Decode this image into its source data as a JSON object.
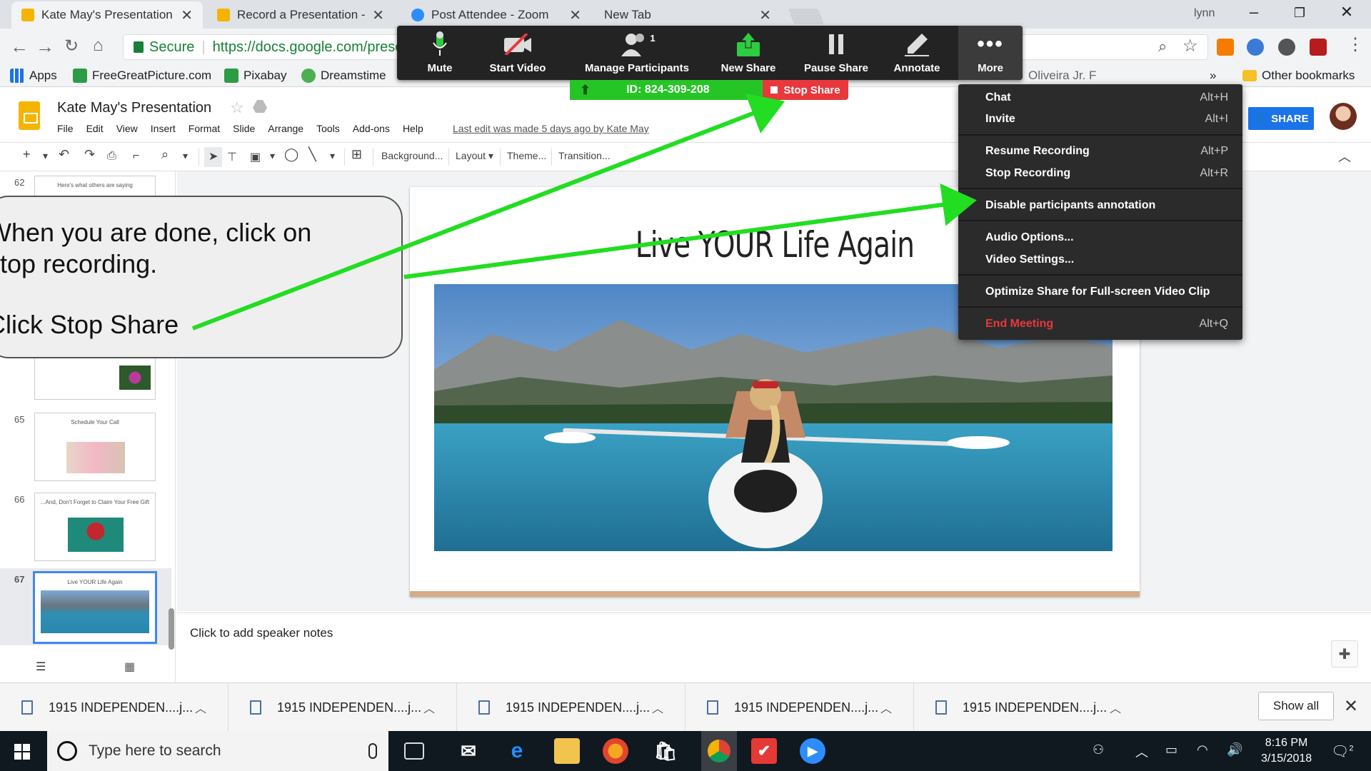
{
  "browser": {
    "tabs": [
      {
        "title": "Kate May's Presentation",
        "fav_color": "#f4b400"
      },
      {
        "title": "Record a Presentation - (",
        "fav_color": "#f4b400"
      },
      {
        "title": "Post Attendee - Zoom",
        "fav_color": "#2d8cff"
      },
      {
        "title": "New Tab",
        "fav_color": ""
      }
    ],
    "user": "lynn",
    "secure_label": "Secure",
    "url": "https://docs.google.com/prese",
    "bookmarks": [
      {
        "label": "Apps",
        "color": "#1a73e8"
      },
      {
        "label": "FreeGreatPicture.com",
        "color": "#2e9b45"
      },
      {
        "label": "Pixabay",
        "color": "#2e9b45"
      },
      {
        "label": "Dreamstime",
        "color": "#4caf50"
      },
      {
        "label": "Oliveira Jr. F",
        "color": "#888888"
      }
    ],
    "bookmarks_overflow": "»",
    "other_bookmarks": "Other bookmarks"
  },
  "slides": {
    "doc_title": "Kate May's Presentation",
    "menu": [
      "File",
      "Edit",
      "View",
      "Insert",
      "Format",
      "Slide",
      "Arrange",
      "Tools",
      "Add-ons",
      "Help"
    ],
    "last_edit": "Last edit was made 5 days ago by Kate May",
    "share_label": "SHARE",
    "toolbar": {
      "background": "Background...",
      "layout": "Layout",
      "theme": "Theme...",
      "transition": "Transition..."
    },
    "filmstrip": [
      {
        "num": "62",
        "title": "Here's what others are saying"
      },
      {
        "num": "65",
        "title": "Schedule Your Call"
      },
      {
        "num": "66",
        "title": "...And, Don't Forget to Claim Your Free Gift"
      },
      {
        "num": "67",
        "title": "Live YOUR Life Again"
      }
    ],
    "slide_title": "Live YOUR Life Again",
    "speaker_notes_placeholder": "Click to add speaker notes"
  },
  "zoom": {
    "toolbar": [
      {
        "label": "Mute",
        "icon": "microphone-icon"
      },
      {
        "label": "Start Video",
        "icon": "video-off-icon"
      },
      {
        "label": "Manage Participants",
        "icon": "participants-icon",
        "badge": "1"
      },
      {
        "label": "New Share",
        "icon": "share-icon"
      },
      {
        "label": "Pause Share",
        "icon": "pause-icon"
      },
      {
        "label": "Annotate",
        "icon": "pencil-icon"
      },
      {
        "label": "More",
        "icon": "ellipsis-icon"
      }
    ],
    "meeting_id": "ID: 824-309-208",
    "stop_share": "Stop Share",
    "more_menu": [
      {
        "label": "Chat",
        "shortcut": "Alt+H"
      },
      {
        "label": "Invite",
        "shortcut": "Alt+I"
      },
      {
        "label": "Resume Recording",
        "shortcut": "Alt+P"
      },
      {
        "label": "Stop Recording",
        "shortcut": "Alt+R"
      },
      {
        "label": "Disable participants annotation",
        "shortcut": ""
      },
      {
        "label": "Audio Options...",
        "shortcut": ""
      },
      {
        "label": "Video Settings...",
        "shortcut": ""
      },
      {
        "label": "Optimize Share for Full-screen Video Clip",
        "shortcut": ""
      },
      {
        "label": "End Meeting",
        "shortcut": "Alt+Q"
      }
    ]
  },
  "callout": {
    "line1": "When you are done, click on\nstop recording.",
    "line2": "Click Stop Share",
    "arrow_color": "#22dd22"
  },
  "downloads": {
    "items": [
      "1915 INDEPENDEN....j...",
      "1915 INDEPENDEN....j...",
      "1915 INDEPENDEN....j...",
      "1915 INDEPENDEN....j...",
      "1915 INDEPENDEN....j..."
    ],
    "show_all": "Show all"
  },
  "taskbar": {
    "search_placeholder": "Type here to search",
    "time": "8:16 PM",
    "date": "3/15/2018",
    "notification_count": "2"
  }
}
